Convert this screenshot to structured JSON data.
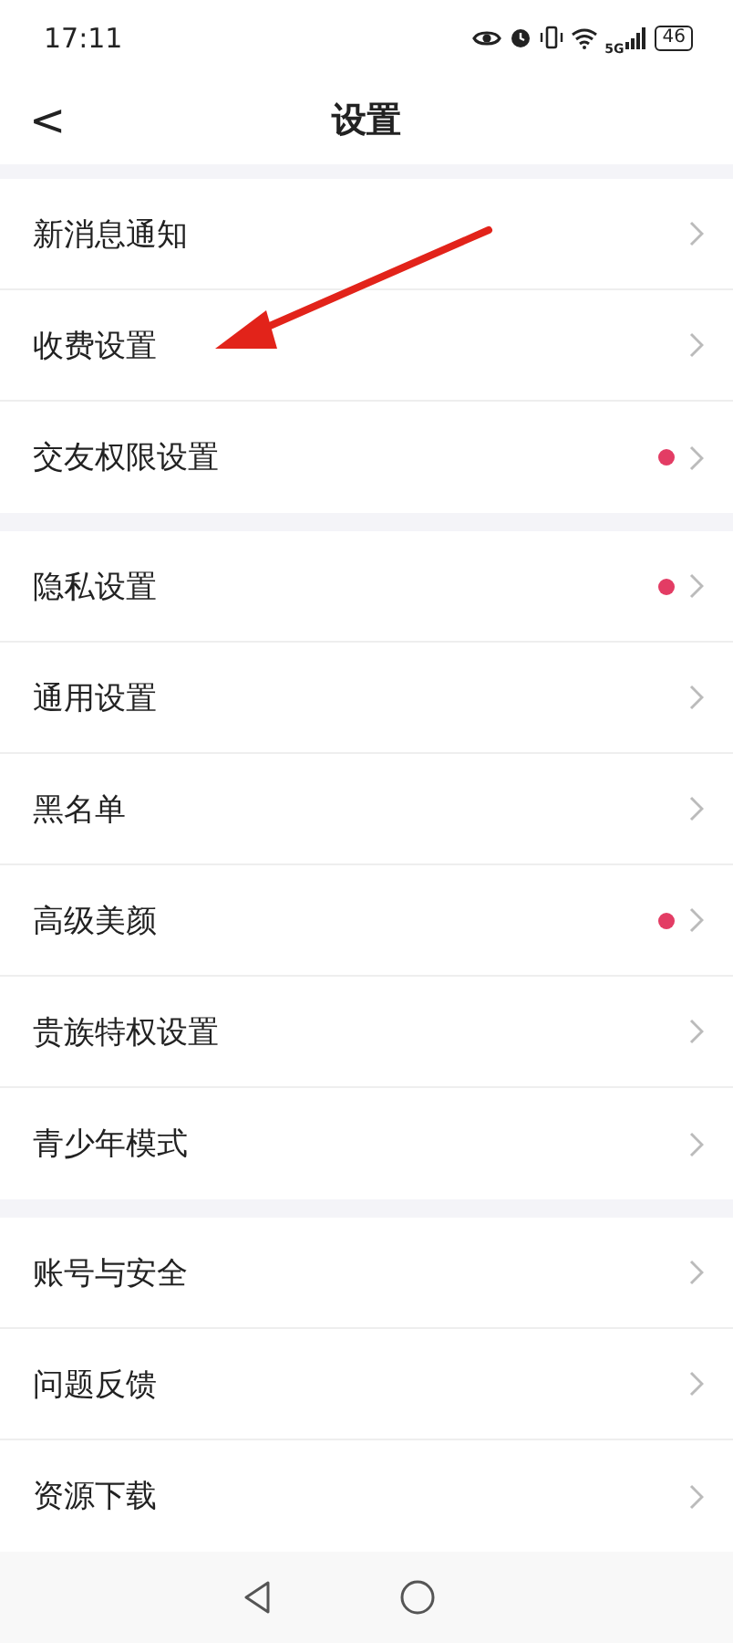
{
  "status_bar": {
    "time": "17:11",
    "network": "5G",
    "battery": "46"
  },
  "header": {
    "back": "<",
    "title": "设置"
  },
  "groups": [
    {
      "items": [
        {
          "label": "新消息通知",
          "dot": false
        },
        {
          "label": "收费设置",
          "dot": false
        },
        {
          "label": "交友权限设置",
          "dot": true
        }
      ]
    },
    {
      "items": [
        {
          "label": "隐私设置",
          "dot": true
        },
        {
          "label": "通用设置",
          "dot": false
        },
        {
          "label": "黑名单",
          "dot": false
        },
        {
          "label": "高级美颜",
          "dot": true
        },
        {
          "label": "贵族特权设置",
          "dot": false
        },
        {
          "label": "青少年模式",
          "dot": false
        }
      ]
    },
    {
      "items": [
        {
          "label": "账号与安全",
          "dot": false
        },
        {
          "label": "问题反馈",
          "dot": false
        },
        {
          "label": "资源下载",
          "dot": false
        }
      ]
    }
  ],
  "annotation": {
    "kind": "arrow"
  }
}
